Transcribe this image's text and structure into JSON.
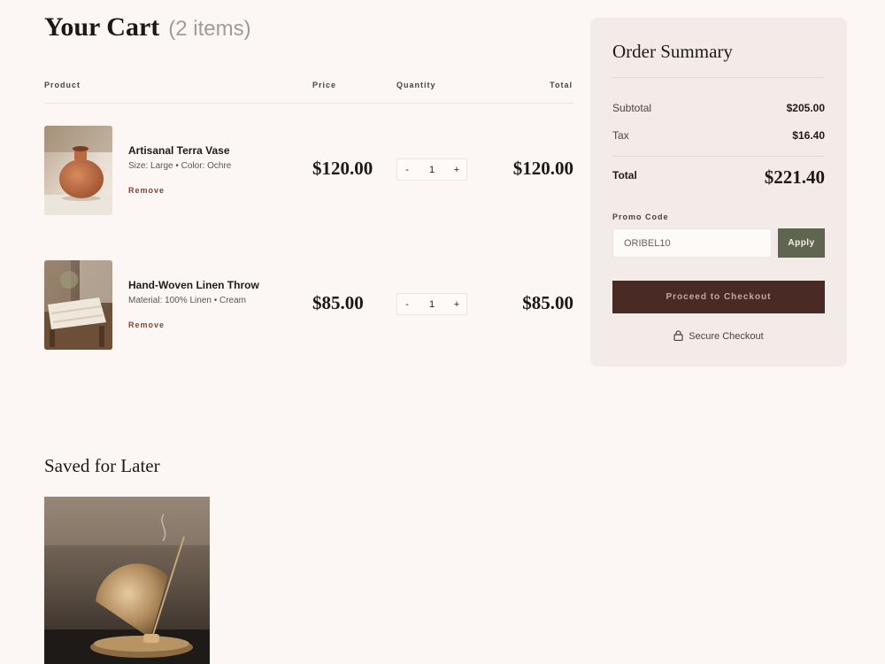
{
  "cart": {
    "title": "Your Cart",
    "count": "(2 items)"
  },
  "table_headers": {
    "product": "Product",
    "price": "Price",
    "quantity": "Quantity",
    "total": "Total"
  },
  "items": [
    {
      "name": "Artisanal Terra Vase",
      "desc": "Size: Large • Color: Ochre",
      "remove": "Remove",
      "price": "$120.00",
      "qty_minus": "-",
      "qty": "1",
      "qty_plus": "+",
      "total": "$120.00"
    },
    {
      "name": "Hand-Woven Linen Throw",
      "desc": "Material: 100% Linen • Cream",
      "remove": "Remove",
      "price": "$85.00",
      "qty_minus": "-",
      "qty": "1",
      "qty_plus": "+",
      "total": "$85.00"
    }
  ],
  "summary": {
    "title": "Order Summary",
    "subtotal_label": "Subtotal",
    "subtotal_value": "$205.00",
    "tax_label": "Tax",
    "tax_value": "$16.40",
    "total_label": "Total",
    "total_value": "$221.40",
    "promo_label": "Promo Code",
    "promo_value": "ORIBEL10",
    "apply_label": "Apply",
    "checkout_label": "Proceed to Checkout",
    "secure_label": "Secure Checkout",
    "secure_icon": "lock-icon"
  },
  "saved": {
    "title": "Saved for Later"
  },
  "colors": {
    "background": "#fcf7f5",
    "summary_panel": "#f3ebe8",
    "apply_button": "#5f6550",
    "checkout_button": "#4a2a24",
    "remove_link": "#8a3f2c"
  }
}
